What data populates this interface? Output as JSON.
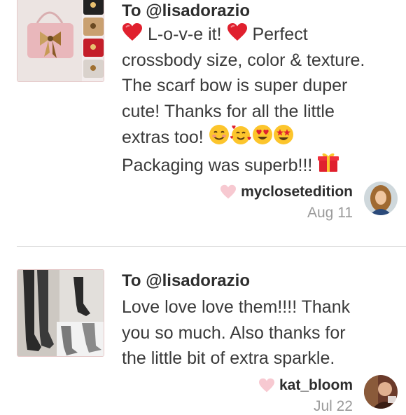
{
  "reviews": [
    {
      "to": "To @lisadorazio",
      "lines": [
        "L-o-v-e it!",
        "Perfect",
        "crossbody size, color & texture.",
        "The scarf bow is super duper",
        "cute! Thanks for all the little",
        "extras too!",
        "Packaging was superb!!!"
      ],
      "username": "myclosetedition",
      "date": "Aug 11"
    },
    {
      "to": "To @lisadorazio",
      "lines": [
        "Love love love them!!!! Thank",
        "you so much. Also thanks for",
        "the little bit of extra sparkle."
      ],
      "username": "kat_bloom",
      "date": "Jul 22"
    }
  ],
  "icons": {
    "like": "heart-outline-icon",
    "emphasis": "red-heart-emoji",
    "emoji_1": "smiling-face-emoji",
    "emoji_2": "smiling-face-with-hearts-emoji",
    "emoji_3": "heart-eyes-emoji",
    "emoji_4": "star-struck-emoji",
    "gift": "wrapped-gift-emoji"
  },
  "colors": {
    "heart_outline": "#f7c9d1",
    "emoji_red": "#e0202e",
    "emoji_yellow": "#fcc52c",
    "date_gray": "#9a9a9a"
  }
}
